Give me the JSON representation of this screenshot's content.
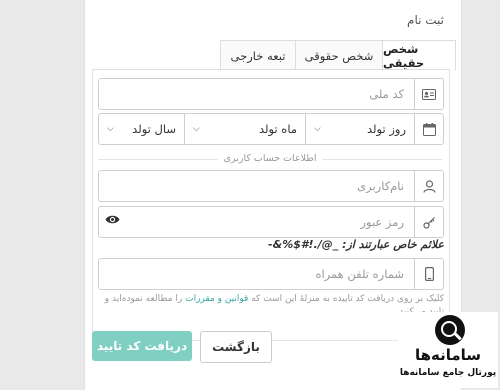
{
  "form_title": "ثبت نام",
  "tabs": [
    {
      "label": "شخص حقیقی",
      "active": true
    },
    {
      "label": "شخص حقوقی",
      "active": false
    },
    {
      "label": "تبعه خارجی",
      "active": false
    }
  ],
  "national_code": {
    "placeholder": "کد ملی",
    "icon": "id-card-icon"
  },
  "birth_date": {
    "icon": "calendar-icon",
    "day": "روز تولد",
    "month": "ماه تولد",
    "year": "سال تولد"
  },
  "account_section_label": "اطلاعات حساب کاربری",
  "username": {
    "placeholder": "نام‌کاربری",
    "icon": "user-icon"
  },
  "password": {
    "placeholder": "رمز عبور",
    "icon": "key-icon"
  },
  "special_chars_note": "علائم خاص عبارتند از: _@/.!#$%&-",
  "phone": {
    "placeholder": "شماره تلفن همراه",
    "icon": "mobile-icon"
  },
  "terms": {
    "before": "کلیک بر روی دریافت کد تاییده به منزلهٔ این است که ",
    "link": "قوانین و مقررات",
    "after": " را مطالعه نموده‌اید و تایید می‌کنید"
  },
  "buttons": {
    "submit": "دریافت کد تایید",
    "back": "بازگشت"
  },
  "logo": {
    "name": "سامانه‌ها",
    "subtitle": "پورتال جامع سامانه‌ها"
  },
  "colors": {
    "primary_button": "#7fcfc3",
    "link": "#3aa7a0"
  }
}
